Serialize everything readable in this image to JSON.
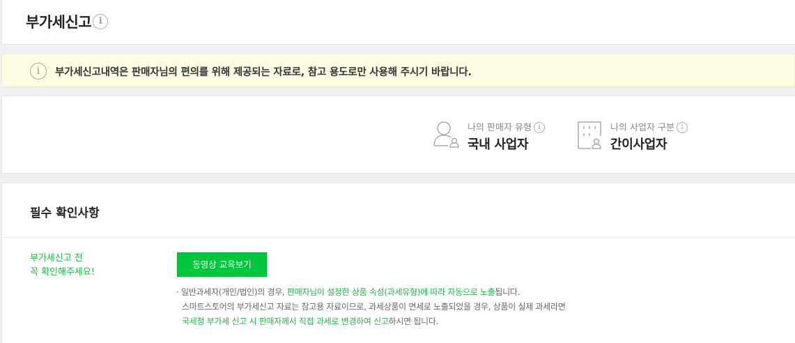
{
  "page": {
    "title": "부가세신고"
  },
  "notice": {
    "text": "부가세신고내역은 판매자님의 편의를 위해 제공되는 자료로, 참고 용도로만 사용해 주시기 바랍니다."
  },
  "seller_info": {
    "seller_type_label": "나의 판매자 유형",
    "seller_type_value": "국내 사업자",
    "business_type_label": "나의 사업자 구분",
    "business_type_value": "간이사업자"
  },
  "required": {
    "title": "필수 확인사항",
    "side_note_line1": "부가세신고 전",
    "side_note_line2": "꼭 확인해주세요!",
    "video_button_label": "동영상 교육보기",
    "desc": {
      "line1_part1": "· 일반과세자(개인/법인)의 경우, ",
      "line1_green": "판매자님이 설정한 상품 속성(과세유형)에 따라 자동으로 노출",
      "line1_part2": "됩니다.",
      "line2": "스마트스토어의 부가세신고 자료는 참고용 자료이므로, 과세상품이 면세로 노출되었을 경우, 상품이 실제 과세라면",
      "line3_green": "국세청 부가세 신고 시 판매자께서 직접 과세로 변경하여 신고",
      "line3_part2": "하시면 됩니다."
    }
  },
  "colors": {
    "accent_green": "#00c73c",
    "notice_bg": "#fcfbe4"
  },
  "icons": {
    "info": "info-circle-icon",
    "seller": "person-icon",
    "business": "building-icon"
  }
}
